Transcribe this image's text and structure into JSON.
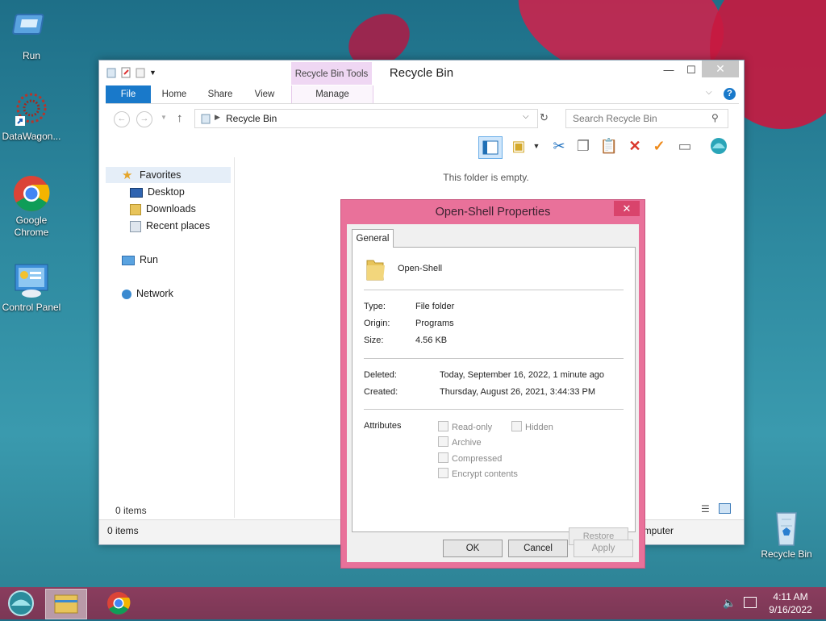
{
  "desktop": {
    "icons": [
      {
        "label": "Run"
      },
      {
        "label": "DataWagon..."
      },
      {
        "label": "Google Chrome"
      },
      {
        "label": "Control Panel"
      },
      {
        "label": "Recycle Bin"
      }
    ]
  },
  "explorer": {
    "title": "Recycle Bin",
    "context_tab": "Recycle Bin Tools",
    "ribbon_tabs": [
      "File",
      "Home",
      "Share",
      "View",
      "Manage"
    ],
    "address": "Recycle Bin",
    "search_placeholder": "Search Recycle Bin",
    "sidebar": {
      "favorites": "Favorites",
      "desktop": "Desktop",
      "downloads": "Downloads",
      "recent": "Recent places",
      "run": "Run",
      "network": "Network"
    },
    "empty_message": "This folder is empty.",
    "items_count": "0 items",
    "status_items": "0 items",
    "status_right": "omputer"
  },
  "dialog": {
    "title": "Open-Shell Properties",
    "tab": "General",
    "name": "Open-Shell",
    "type_label": "Type:",
    "type_value": "File folder",
    "origin_label": "Origin:",
    "origin_value": "Programs",
    "size_label": "Size:",
    "size_value": "4.56 KB",
    "deleted_label": "Deleted:",
    "deleted_value": "Today, September 16, 2022, 1 minute ago",
    "created_label": "Created:",
    "created_value": "Thursday, August 26, 2021, 3:44:33 PM",
    "attributes_label": "Attributes",
    "attributes": {
      "readonly": "Read-only",
      "hidden": "Hidden",
      "archive": "Archive",
      "compressed": "Compressed",
      "encrypt": "Encrypt contents"
    },
    "restore": "Restore",
    "ok": "OK",
    "cancel": "Cancel",
    "apply": "Apply"
  },
  "taskbar": {
    "time": "4:11 AM",
    "date": "9/16/2022"
  }
}
